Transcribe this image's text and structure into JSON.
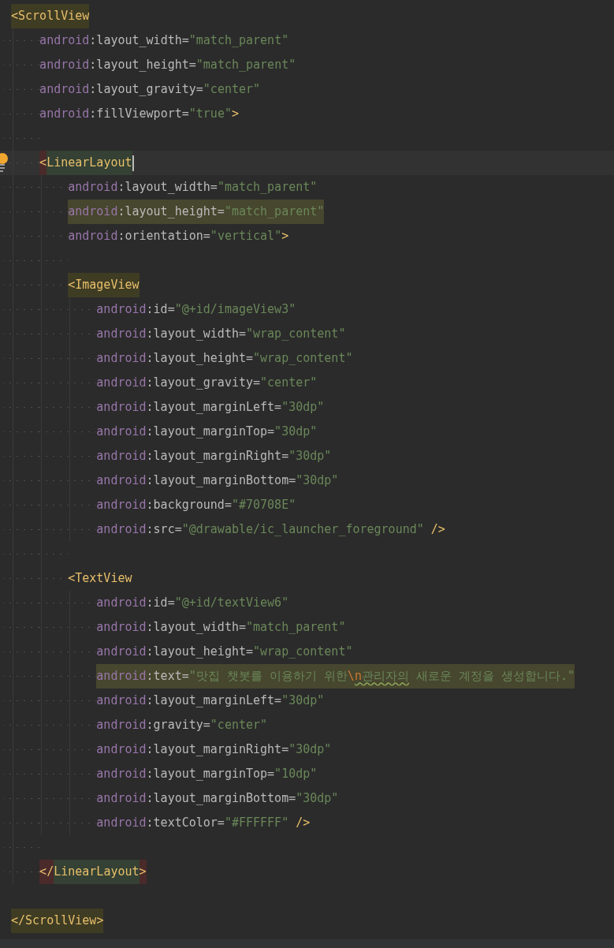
{
  "syntax": {
    "tag_open": "<",
    "tag_end_open": "</",
    "tag_close": ">",
    "self_close": "/>",
    "equals": "=",
    "quote": "\"",
    "ns_sep": ":"
  },
  "root": {
    "tag": "ScrollView",
    "close_tag": "ScrollView",
    "open_highlighted": true,
    "close_highlighted": true,
    "current_line": false,
    "self_closing": false,
    "attributes": [
      {
        "namespace": "android",
        "name": "layout_width",
        "value": "match_parent",
        "highlighted": false
      },
      {
        "namespace": "android",
        "name": "layout_height",
        "value": "match_parent",
        "highlighted": false
      },
      {
        "namespace": "android",
        "name": "layout_gravity",
        "value": "center",
        "highlighted": false
      },
      {
        "namespace": "android",
        "name": "fillViewport",
        "value": "true",
        "highlighted": false
      }
    ],
    "children": [
      {
        "tag": "LinearLayout",
        "close_tag": "LinearLayout",
        "open_highlighted": true,
        "close_highlighted": true,
        "current_line": true,
        "self_closing": false,
        "attributes": [
          {
            "namespace": "android",
            "name": "layout_width",
            "value": "match_parent",
            "highlighted": false
          },
          {
            "namespace": "android",
            "name": "layout_height",
            "value": "match_parent",
            "highlighted": true
          },
          {
            "namespace": "android",
            "name": "orientation",
            "value": "vertical",
            "highlighted": false
          }
        ],
        "children": [
          {
            "tag": "ImageView",
            "open_highlighted": true,
            "current_line": false,
            "self_closing": true,
            "attributes": [
              {
                "namespace": "android",
                "name": "id",
                "value": "@+id/imageView3",
                "highlighted": false
              },
              {
                "namespace": "android",
                "name": "layout_width",
                "value": "wrap_content",
                "highlighted": false
              },
              {
                "namespace": "android",
                "name": "layout_height",
                "value": "wrap_content",
                "highlighted": false
              },
              {
                "namespace": "android",
                "name": "layout_gravity",
                "value": "center",
                "highlighted": false
              },
              {
                "namespace": "android",
                "name": "layout_marginLeft",
                "value": "30dp",
                "highlighted": false
              },
              {
                "namespace": "android",
                "name": "layout_marginTop",
                "value": "30dp",
                "highlighted": false
              },
              {
                "namespace": "android",
                "name": "layout_marginRight",
                "value": "30dp",
                "highlighted": false
              },
              {
                "namespace": "android",
                "name": "layout_marginBottom",
                "value": "30dp",
                "highlighted": false
              },
              {
                "namespace": "android",
                "name": "background",
                "value": "#70708E",
                "highlighted": false
              },
              {
                "namespace": "android",
                "name": "src",
                "value": "@drawable/ic_launcher_foreground",
                "highlighted": false
              }
            ]
          },
          {
            "tag": "TextView",
            "open_highlighted": false,
            "current_line": false,
            "self_closing": true,
            "attributes": [
              {
                "namespace": "android",
                "name": "id",
                "value": "@+id/textView6",
                "highlighted": false
              },
              {
                "namespace": "android",
                "name": "layout_width",
                "value": "match_parent",
                "highlighted": false
              },
              {
                "namespace": "android",
                "name": "layout_height",
                "value": "wrap_content",
                "highlighted": false
              },
              {
                "namespace": "android",
                "name": "text",
                "highlighted": true,
                "value_parts": [
                  {
                    "text": "맛집 챗봇를 이용하기 위한",
                    "kind": "string",
                    "typo": false
                  },
                  {
                    "text": "\\",
                    "kind": "escape",
                    "typo": false
                  },
                  {
                    "text": "n",
                    "kind": "escape",
                    "typo": true
                  },
                  {
                    "text": "관리자의",
                    "kind": "string",
                    "typo": true
                  },
                  {
                    "text": " 새로운 계정을 생성합니다.",
                    "kind": "string",
                    "typo": false
                  }
                ]
              },
              {
                "namespace": "android",
                "name": "layout_marginLeft",
                "value": "30dp",
                "highlighted": false
              },
              {
                "namespace": "android",
                "name": "gravity",
                "value": "center",
                "highlighted": false
              },
              {
                "namespace": "android",
                "name": "layout_marginRight",
                "value": "30dp",
                "highlighted": false
              },
              {
                "namespace": "android",
                "name": "layout_marginTop",
                "value": "10dp",
                "highlighted": false
              },
              {
                "namespace": "android",
                "name": "layout_marginBottom",
                "value": "30dp",
                "highlighted": false
              },
              {
                "namespace": "android",
                "name": "textColor",
                "value": "#FFFFFF",
                "highlighted": false
              }
            ]
          }
        ]
      }
    ]
  }
}
